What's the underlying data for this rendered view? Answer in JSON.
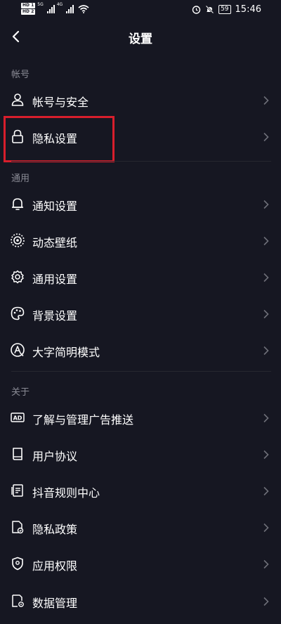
{
  "status_bar": {
    "hd1": "HD 1",
    "hd2": "HD 2",
    "net1": "5G",
    "net2": "4G",
    "battery": "59",
    "time": "15:46"
  },
  "nav": {
    "title": "设置"
  },
  "sections": {
    "account": "帐号",
    "general": "通用",
    "about": "关于"
  },
  "items": {
    "account_security": "帐号与安全",
    "privacy_settings": "隐私设置",
    "notification_settings": "通知设置",
    "live_wallpaper": "动态壁纸",
    "general_settings": "通用设置",
    "background_settings": "背景设置",
    "large_text_mode": "大字简明模式",
    "ad_management": "了解与管理广告推送",
    "user_agreement": "用户协议",
    "community_rules": "抖音规则中心",
    "privacy_policy": "隐私政策",
    "app_permissions": "应用权限",
    "data_management": "数据管理"
  },
  "icons": {
    "ad_icon_text": "AD"
  },
  "colors": {
    "background": "#161722",
    "highlight_box": "#d81e2c",
    "section_label": "#8a8b95"
  }
}
